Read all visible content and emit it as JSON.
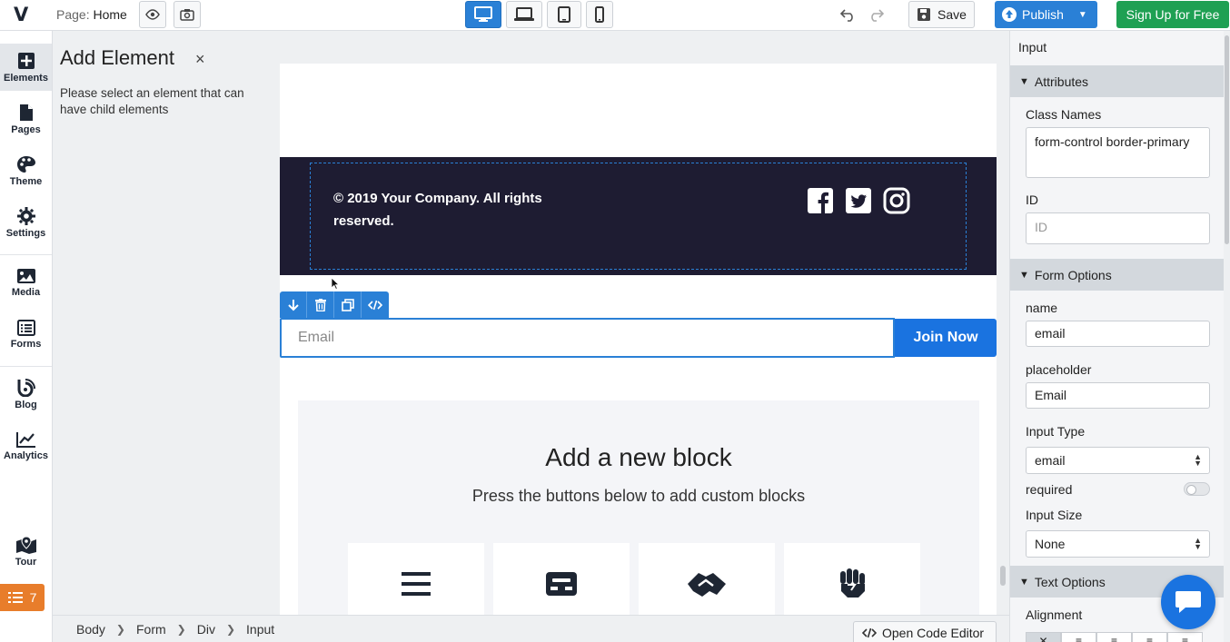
{
  "topbar": {
    "logo": "V",
    "page_prefix": "Page:",
    "page_name": "Home",
    "save_label": "Save",
    "publish_label": "Publish",
    "signup_label": "Sign Up for Free",
    "active_device": "desktop"
  },
  "leftnav": {
    "items": [
      {
        "label": "Elements",
        "icon": "plus-square-icon",
        "active": true
      },
      {
        "label": "Pages",
        "icon": "file-icon"
      },
      {
        "label": "Theme",
        "icon": "palette-icon"
      },
      {
        "label": "Settings",
        "icon": "gear-icon"
      },
      {
        "label": "Media",
        "icon": "image-icon"
      },
      {
        "label": "Forms",
        "icon": "list-icon"
      },
      {
        "label": "Blog",
        "icon": "blog-icon"
      },
      {
        "label": "Analytics",
        "icon": "chart-line-icon"
      },
      {
        "label": "Tour",
        "icon": "map-marker-icon"
      }
    ],
    "task_count": "7"
  },
  "addpanel": {
    "title": "Add Element",
    "close": "×",
    "message": "Please select an element that can have child elements"
  },
  "canvas": {
    "copyright": "© 2019 Your Company. All rights reserved.",
    "email_placeholder": "Email",
    "join_label": "Join Now",
    "block_title": "Add a new block",
    "block_subtitle": "Press the buttons below to add custom blocks"
  },
  "breadcrumb": [
    "Body",
    "Form",
    "Div",
    "Input"
  ],
  "code_editor_label": "Open Code Editor",
  "rightpanel": {
    "title": "Input",
    "attributes": {
      "header": "Attributes",
      "class_label": "Class Names",
      "class_value": "form-control border-primary",
      "id_label": "ID",
      "id_placeholder": "ID"
    },
    "form_options": {
      "header": "Form Options",
      "name_label": "name",
      "name_value": "email",
      "placeholder_label": "placeholder",
      "placeholder_value": "Email",
      "input_type_label": "Input Type",
      "input_type_value": "email",
      "required_label": "required",
      "required": false,
      "input_size_label": "Input Size",
      "input_size_value": "None"
    },
    "text_options": {
      "header": "Text Options",
      "alignment_label": "Alignment"
    }
  },
  "colors": {
    "accent": "#2a80d6",
    "signup": "#1fa053",
    "footer": "#1e1c32",
    "task_badge": "#e87d2b"
  }
}
